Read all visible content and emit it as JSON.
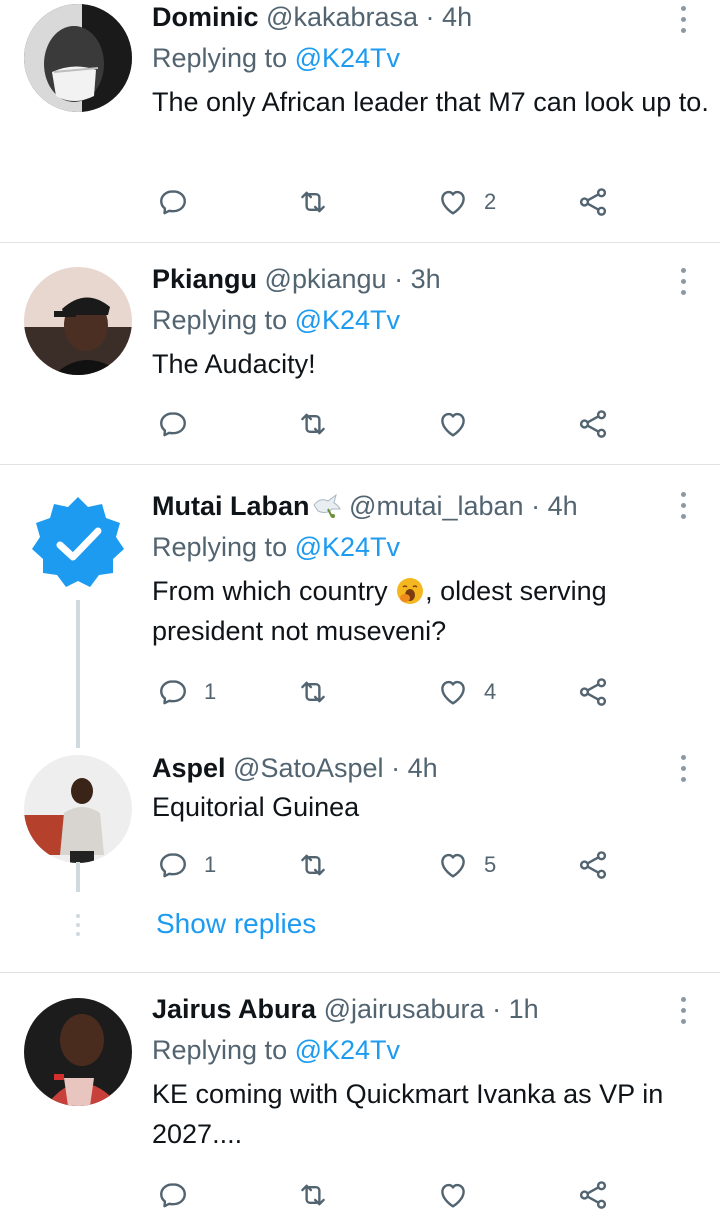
{
  "tweets": [
    {
      "name": "Dominic",
      "handle": "@kakabrasa",
      "time": "4h",
      "replying_label": "Replying to",
      "replying_to": "@K24Tv",
      "text": "The only African leader that M7 can look up to.",
      "replies": "",
      "likes": "2"
    },
    {
      "name": "Pkiangu",
      "handle": "@pkiangu",
      "time": "3h",
      "replying_label": "Replying to",
      "replying_to": "@K24Tv",
      "text": "The Audacity!",
      "replies": "",
      "likes": ""
    },
    {
      "name": "Mutai Laban",
      "handle": "@mutai_laban",
      "time": "4h",
      "replying_label": "Replying to",
      "replying_to": "@K24Tv",
      "text_before_emoji": "From which country",
      "text_after_emoji": ", oldest serving president not museveni?",
      "name_emoji": "dove-icon",
      "inline_emoji": "yawning-face-icon",
      "replies": "1",
      "likes": "4"
    },
    {
      "name": "Aspel",
      "handle": "@SatoAspel",
      "time": "4h",
      "text": "Equitorial Guinea",
      "replies": "1",
      "likes": "5"
    },
    {
      "name": "Jairus Abura",
      "handle": "@jairusabura",
      "time": "1h",
      "replying_label": "Replying to",
      "replying_to": "@K24Tv",
      "text": "KE coming with Quickmart Ivanka as VP in 2027....",
      "replies": "",
      "likes": ""
    }
  ],
  "show_replies": "Show replies",
  "separator": "·",
  "colors": {
    "link": "#1d9bf0",
    "muted": "#536471",
    "verified": "#1d9bf0",
    "divider": "#dfe3e6"
  }
}
